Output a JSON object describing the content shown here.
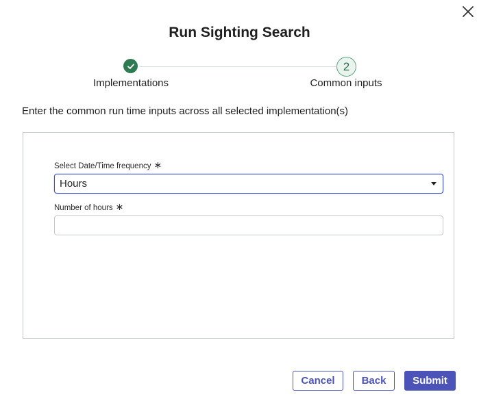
{
  "dialog": {
    "title": "Run Sighting Search",
    "close_icon": "close-icon"
  },
  "stepper": {
    "steps": [
      {
        "label": "Implementations",
        "state": "completed",
        "icon": "checkmark-icon"
      },
      {
        "label": "Common inputs",
        "state": "current",
        "number": "2"
      }
    ],
    "colors": {
      "completed": "#2e7a52",
      "current_border": "#5ea57d",
      "current_fill": "#eaf4ee"
    }
  },
  "instructions": "Enter the common run time inputs across all selected implementation(s)",
  "form": {
    "frequency": {
      "label": "Select Date/Time frequency",
      "required_marker": "∗",
      "value": "Hours"
    },
    "hours": {
      "label": "Number of hours",
      "required_marker": "∗",
      "value": "",
      "placeholder": ""
    }
  },
  "actions": {
    "cancel_label": "Cancel",
    "back_label": "Back",
    "submit_label": "Submit",
    "accent_color": "#4b52b8"
  }
}
